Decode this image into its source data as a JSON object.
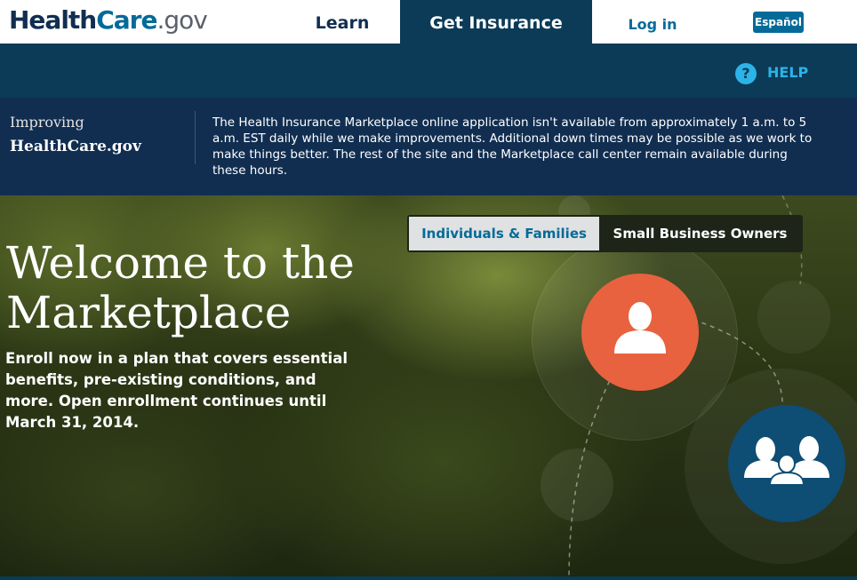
{
  "logo": {
    "health": "Health",
    "care": "Care",
    "gov": ".gov"
  },
  "nav": {
    "learn": "Learn",
    "get_insurance": "Get Insurance",
    "login": "Log in",
    "espanol": "Español"
  },
  "help": {
    "icon": "?",
    "label": "HELP"
  },
  "notice": {
    "heading_line1": "Improving",
    "heading_line2": "HealthCare.gov",
    "text": "The Health Insurance Marketplace online application isn't available from approximately 1 a.m. to 5 a.m. EST daily while we make improvements. Additional down times may be possible as we work to make things better. The rest of the site and the Marketplace call center remain available during these hours."
  },
  "hero": {
    "title_line1": "Welcome to the",
    "title_line2": "Marketplace",
    "subtitle": "Enroll now in a plan that covers essential benefits, pre-existing conditions, and more. Open enrollment continues until March 31, 2014.",
    "tabs": [
      {
        "label": "Individuals & Families",
        "active": true
      },
      {
        "label": "Small Business Owners",
        "active": false
      }
    ],
    "icons": {
      "individual": "person-icon",
      "family": "family-icon"
    }
  },
  "colors": {
    "navy": "#112e51",
    "dark_blue": "#0b3b57",
    "link_blue": "#046b99",
    "help_blue": "#2cb3e8",
    "orange": "#e8623f",
    "family_blue": "#0e4d74"
  }
}
